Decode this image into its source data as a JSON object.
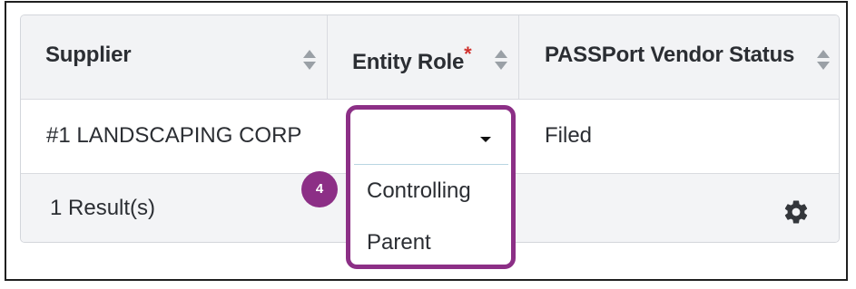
{
  "table": {
    "columns": [
      {
        "label": "Supplier",
        "required": false
      },
      {
        "label": "Entity Role",
        "required": true,
        "required_marker": "*"
      },
      {
        "label": "PASSPort Vendor Status",
        "required": false
      }
    ],
    "rows": [
      {
        "supplier": "#1 LANDSCAPING CORP",
        "entity_role": "",
        "vendor_status": "Filed"
      }
    ],
    "footer": {
      "result_count": "1 Result(s)"
    }
  },
  "entity_role_dropdown": {
    "selected_value": "",
    "options": [
      "Controlling",
      "Parent"
    ]
  },
  "annotation": {
    "step_number": "4",
    "color": "#8c2f86"
  },
  "colors": {
    "required_marker": "#d0312d",
    "header_bg": "#f2f3f5",
    "focus_border": "#b9d6e2"
  },
  "icons": {
    "sort": "sort-icon",
    "caret": "caret-down-icon",
    "settings": "gear-icon"
  }
}
